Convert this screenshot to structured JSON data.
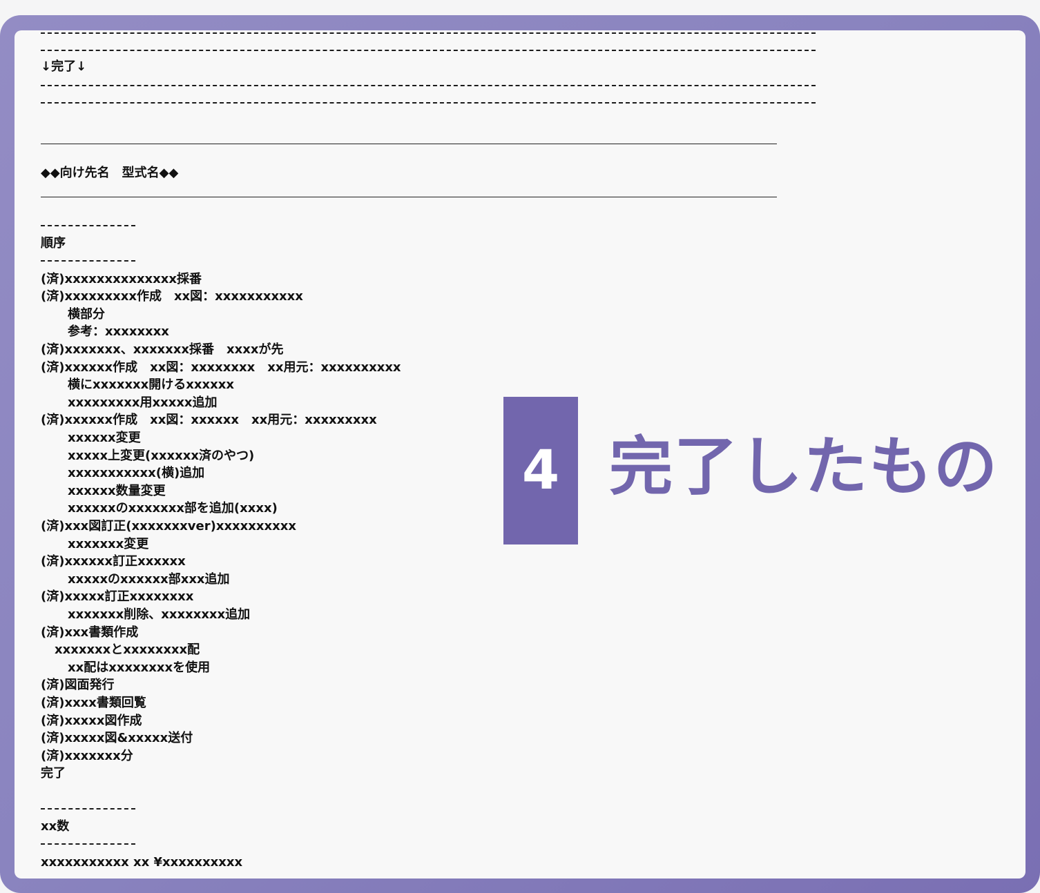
{
  "header": {
    "complete_marker": "↓完了↓"
  },
  "section_title": "◆◆向け先名　型式名◆◆",
  "order_heading": "順序",
  "items": [
    "(済)xxxxxxxxxxxxxx採番",
    "(済)xxxxxxxxx作成　xx図：xxxxxxxxxxx",
    "横部分",
    "参考：xxxxxxxx",
    "(済)xxxxxxx、xxxxxxx採番　xxxxが先",
    "(済)xxxxxx作成　xx図：xxxxxxxx　xx用元：xxxxxxxxxx",
    "横にxxxxxxx開けるxxxxxx",
    "xxxxxxxxx用xxxxx追加",
    "(済)xxxxxx作成　xx図：xxxxxx　xx用元：xxxxxxxxx",
    "xxxxxx変更",
    "xxxxx上変更(xxxxxx済のやつ)",
    "xxxxxxxxxxx(横)追加",
    "xxxxxx数量変更",
    "xxxxxxのxxxxxxx部を追加(xxxx)",
    "(済)xxx図訂正(xxxxxxxver)xxxxxxxxxx",
    "xxxxxxx変更",
    "(済)xxxxxx訂正xxxxxx",
    "xxxxxのxxxxxx部xxx追加",
    "(済)xxxxx訂正xxxxxxxx",
    "xxxxxxx削除、xxxxxxxx追加",
    "(済)xxx書類作成",
    "xxxxxxxとxxxxxxxx配",
    "xx配はxxxxxxxxを使用",
    "(済)図面発行",
    "(済)xxxx書類回覧",
    "(済)xxxxx図作成",
    "(済)xxxxx図&xxxxx送付",
    "(済)xxxxxxx分",
    "完了"
  ],
  "count_heading": "xx数",
  "count_line": "xxxxxxxxxxx xx ¥xxxxxxxxxx",
  "badge": {
    "number": "4",
    "title": "完了したもの",
    "accent_color": "#7266ad"
  }
}
